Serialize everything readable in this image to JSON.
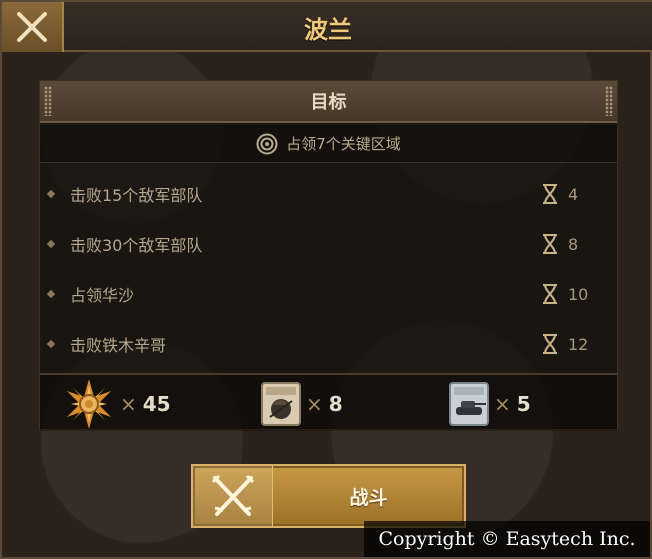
{
  "header": {
    "title": "波兰",
    "close_icon": "close-icon"
  },
  "objectives": {
    "header_label": "目标",
    "main_goal": {
      "icon": "target-icon",
      "text": "占领7个关键区域"
    },
    "items": [
      {
        "label": "击败15个敌军部队",
        "turns": "4"
      },
      {
        "label": "击败30个敌军部队",
        "turns": "8"
      },
      {
        "label": "占领华沙",
        "turns": "10"
      },
      {
        "label": "击败铁木辛哥",
        "turns": "12"
      }
    ],
    "turn_icon": "hourglass-icon"
  },
  "rewards": [
    {
      "icon": "medal-icon",
      "multiplier": "×",
      "count": "45"
    },
    {
      "icon": "infantry-card-icon",
      "multiplier": "×",
      "count": "8"
    },
    {
      "icon": "tank-card-icon",
      "multiplier": "×",
      "count": "5"
    }
  ],
  "battle_button": {
    "label": "战斗",
    "icon": "crossed-rifles-icon"
  },
  "footer": {
    "copyright": "Copyright © Easytech Inc."
  },
  "colors": {
    "accent": "#f0c87a",
    "button": "#b78838",
    "panel": "#14100c"
  }
}
